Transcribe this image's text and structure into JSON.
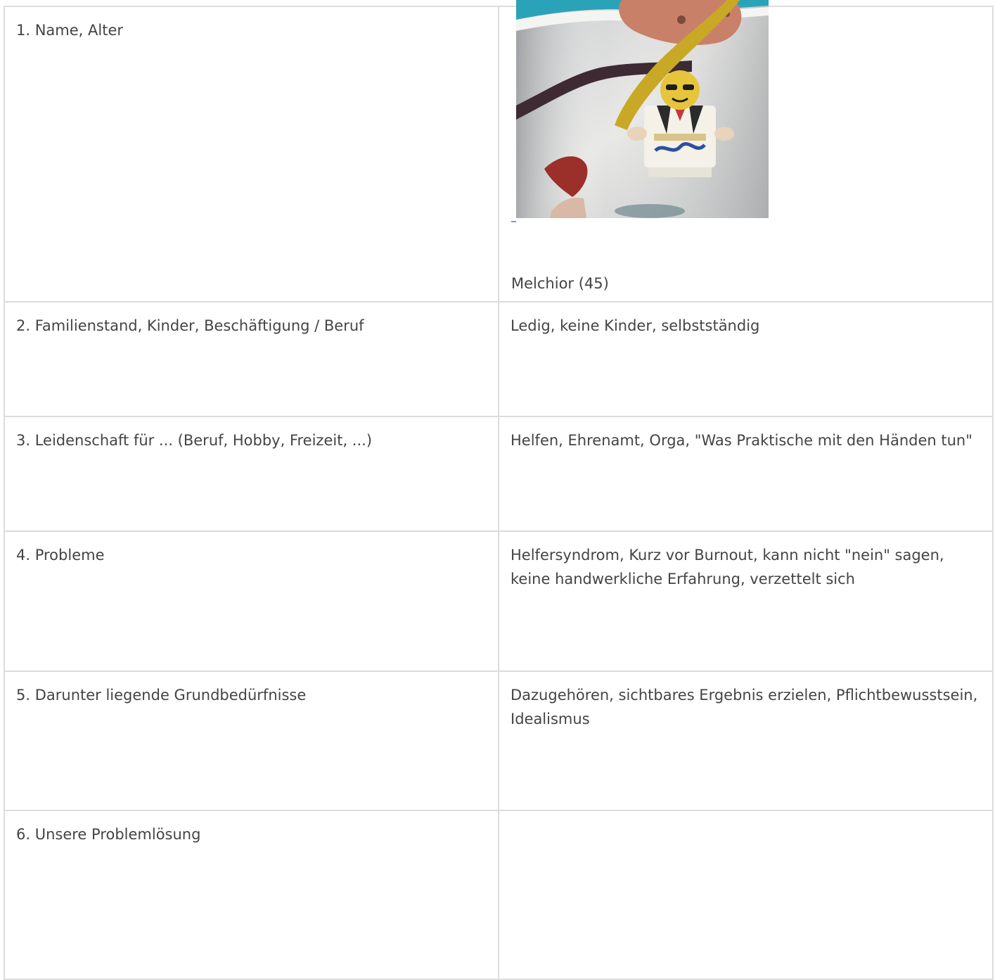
{
  "rows": [
    {
      "question": "1. Name, Alter",
      "answer": "Melchior (45)"
    },
    {
      "question": "2. Familienstand, Kinder, Beschäftigung / Beruf",
      "answer": "Ledig, keine Kinder, selbstständig"
    },
    {
      "question": "3. Leidenschaft für ... (Beruf, Hobby, Freizeit, ...)",
      "answer": "Helfen, Ehrenamt, Orga, \"Was Praktische mit den Händen tun\""
    },
    {
      "question": "4. Probleme",
      "answer": "Helfersyndrom, Kurz vor Burnout, kann nicht \"nein\" sagen, keine handwerkliche Erfahrung, verzettelt sich"
    },
    {
      "question": "5. Darunter liegende Grundbedürfnisse",
      "answer": "Dazugehören, sichtbares Ergebnis erzielen, Pflichtbewusstsein, Idealismus"
    },
    {
      "question": "6. Unsere Problemlösung",
      "answer": ""
    }
  ],
  "colors": {
    "border": "#dcdcdc",
    "text": "#444444",
    "link": "#6aa0c8"
  }
}
